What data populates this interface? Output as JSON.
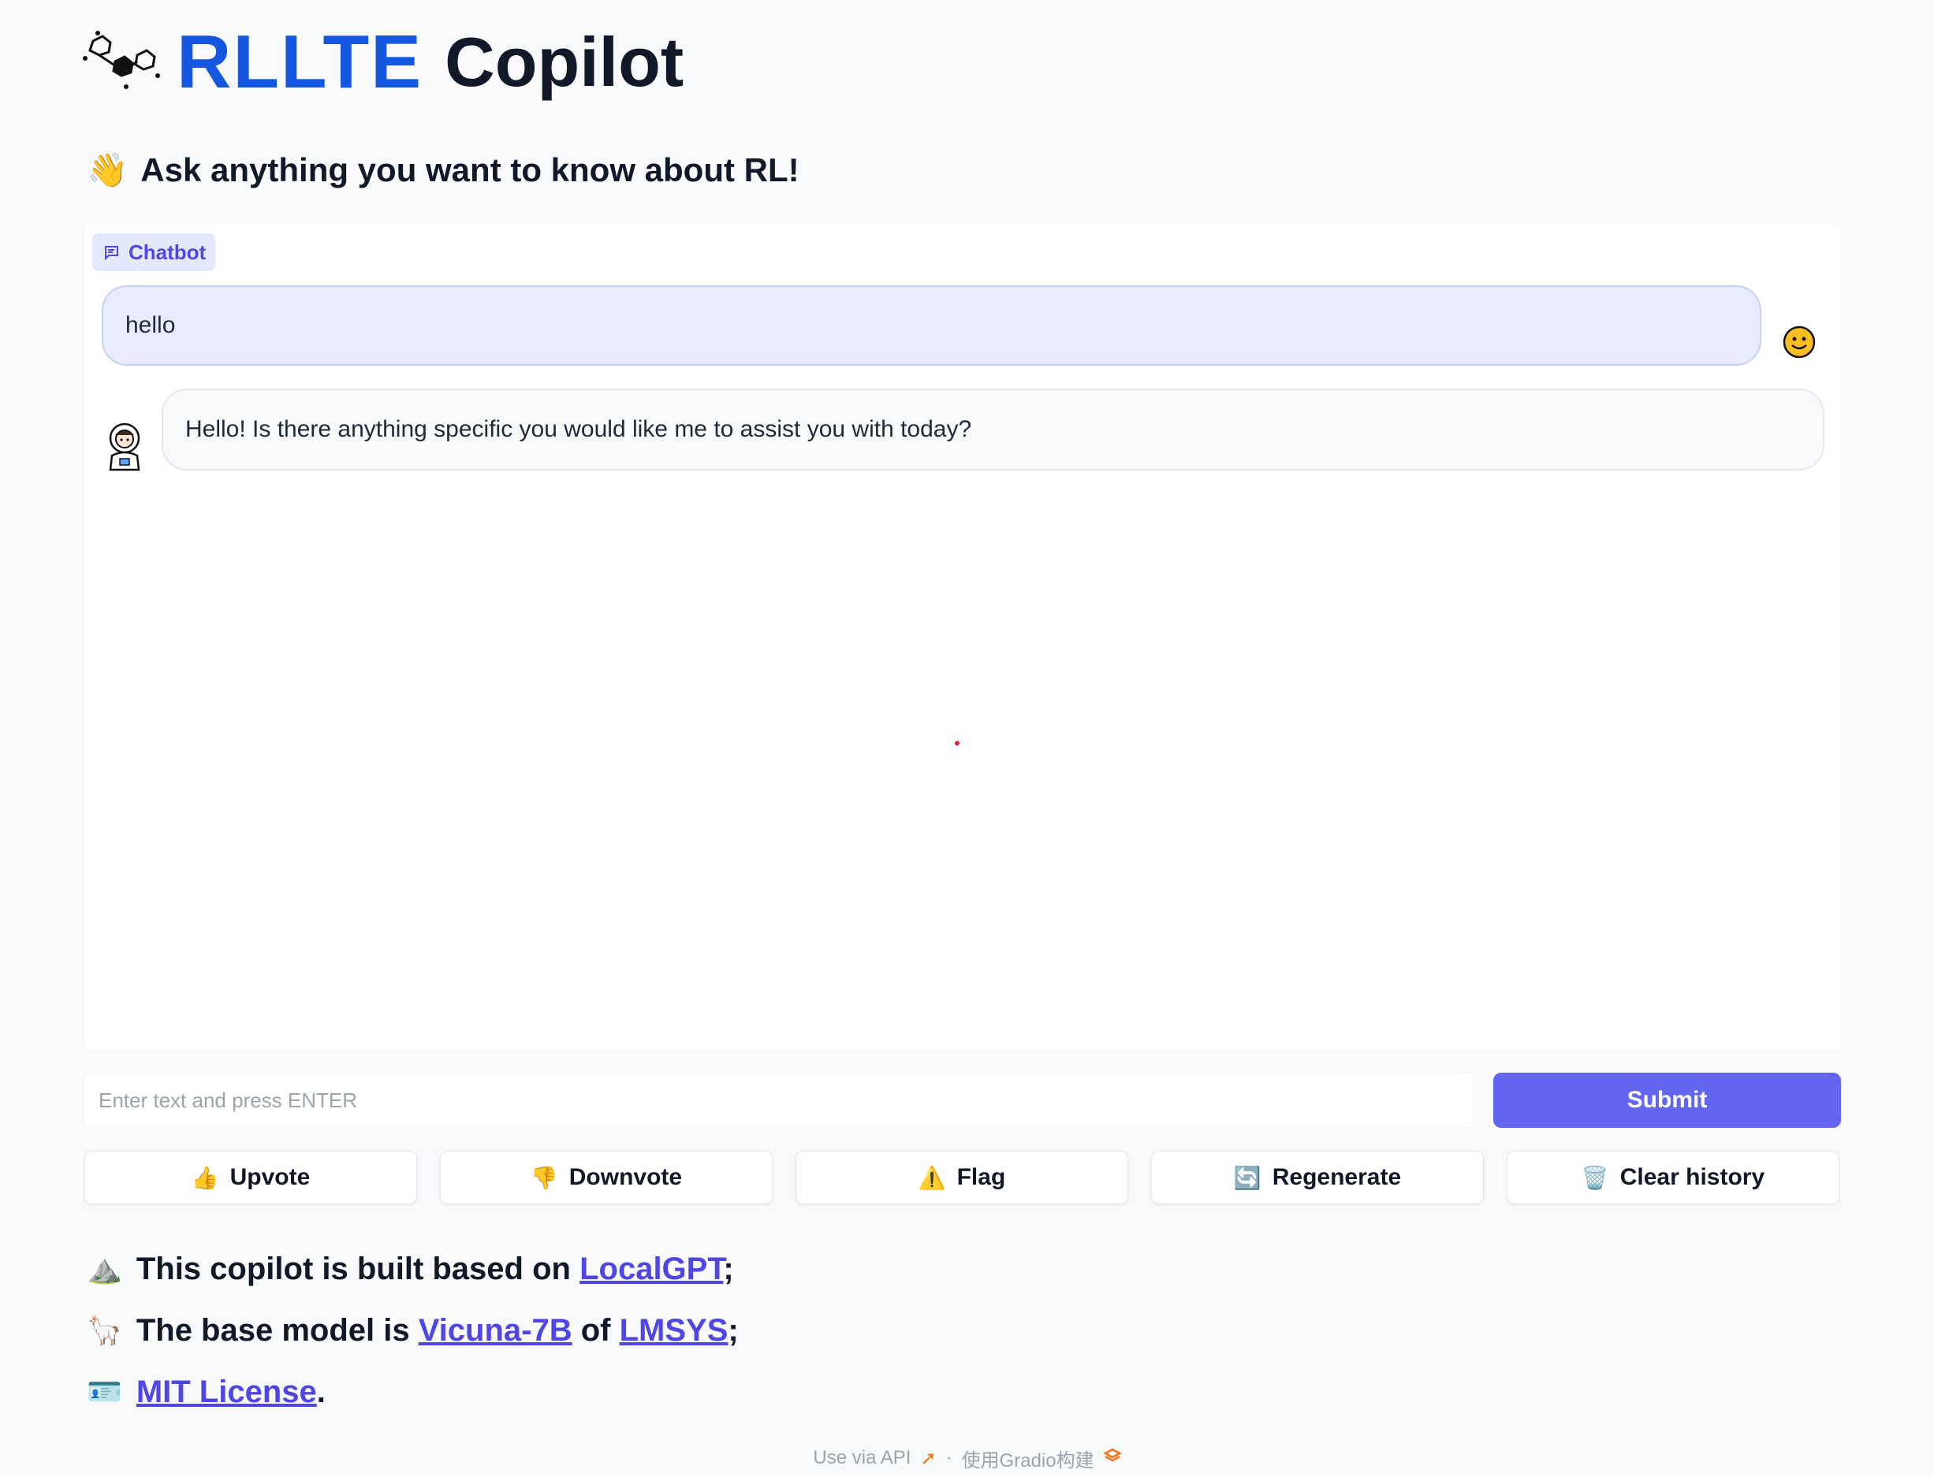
{
  "header": {
    "brand": "RLLTE",
    "brand_rest": "Copilot"
  },
  "subtitle": {
    "emoji": "👋",
    "text": "Ask anything you want to know about RL!"
  },
  "chatbot": {
    "label": "Chatbot",
    "messages": [
      {
        "role": "user",
        "text": "hello"
      },
      {
        "role": "bot",
        "text": "Hello! Is there anything specific you would like me to assist you with today?"
      }
    ]
  },
  "input": {
    "placeholder": "Enter text and press ENTER",
    "submit_label": "Submit"
  },
  "actions": [
    {
      "icon": "👍",
      "label": "Upvote"
    },
    {
      "icon": "👎",
      "label": "Downvote"
    },
    {
      "icon": "⚠️",
      "label": "Flag"
    },
    {
      "icon": "🔄",
      "label": "Regenerate"
    },
    {
      "icon": "🗑️",
      "label": "Clear history"
    }
  ],
  "info": {
    "line1": {
      "icon": "⛰️",
      "prefix": "This copilot is built based on ",
      "link": "LocalGPT",
      "suffix": ";"
    },
    "line2": {
      "icon": "🦙",
      "prefix": "The base model is ",
      "link1": "Vicuna-7B",
      "mid": " of ",
      "link2": "LMSYS",
      "suffix": ";"
    },
    "line3": {
      "icon": "🪪",
      "link": "MIT License",
      "suffix": "."
    }
  },
  "footer": {
    "api": "Use via API",
    "sep": "·",
    "built": "使用Gradio构建"
  },
  "colors": {
    "brand_blue": "#1457e0",
    "accent": "#6366f1",
    "link": "#4f46e5"
  }
}
